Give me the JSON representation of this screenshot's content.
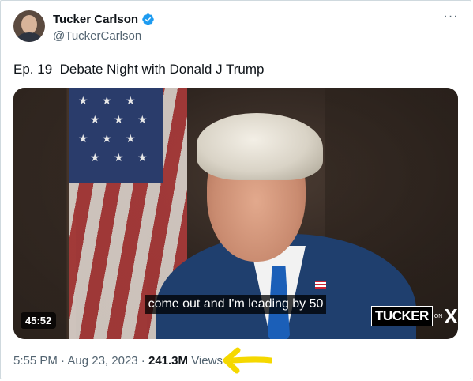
{
  "author": {
    "display_name": "Tucker Carlson",
    "handle": "@TuckerCarlson",
    "verified": true
  },
  "tweet": {
    "text": "Ep. 19  Debate Night with Donald J Trump"
  },
  "video": {
    "caption": "come out and I'm leading by 50",
    "duration": "45:52",
    "logo_text": "TUCKER",
    "logo_on": "ON",
    "logo_x": "X"
  },
  "meta": {
    "time": "5:55 PM",
    "separator": " · ",
    "date": "Aug 23, 2023",
    "views_count": "241.3M",
    "views_label": " Views"
  },
  "colors": {
    "verified": "#1d9bf0",
    "arrow": "#f5d800",
    "secondary_text": "#536471"
  },
  "icons": {
    "more": "more-icon",
    "verified": "verified-badge-icon"
  }
}
